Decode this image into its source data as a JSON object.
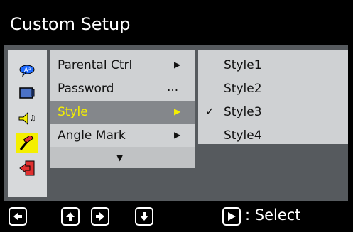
{
  "title": "Custom Setup",
  "sidebar": {
    "icons": [
      {
        "name": "language-icon"
      },
      {
        "name": "display-icon"
      },
      {
        "name": "audio-icon"
      },
      {
        "name": "custom-setup-icon"
      },
      {
        "name": "exit-icon"
      }
    ]
  },
  "menu": {
    "items": [
      {
        "label": "Parental Ctrl",
        "marker": "▶"
      },
      {
        "label": "Password",
        "marker": "..."
      },
      {
        "label": "Style",
        "marker": "▶"
      },
      {
        "label": "Angle Mark",
        "marker": "▶"
      }
    ],
    "more_indicator": "▼"
  },
  "submenu": {
    "items": [
      {
        "label": "Style1",
        "check": ""
      },
      {
        "label": "Style2",
        "check": ""
      },
      {
        "label": "Style3",
        "check": "✓"
      },
      {
        "label": "Style4",
        "check": ""
      }
    ]
  },
  "footer": {
    "select_label": ": Select"
  },
  "colors": {
    "accent": "#f4ef00",
    "background": "#000000",
    "panel": "#cfd1d3"
  }
}
